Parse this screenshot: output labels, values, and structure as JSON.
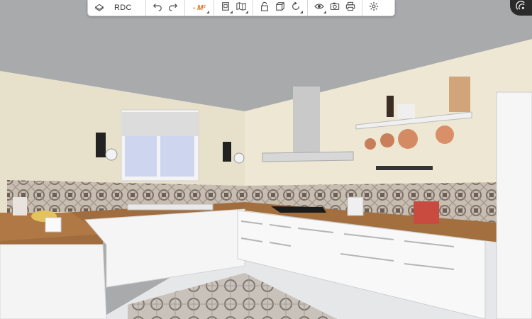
{
  "toolbar": {
    "level_label": "RDC",
    "unit_label": "- M²"
  },
  "icons": {
    "level": "floor-plan-icon",
    "undo": "undo-icon",
    "redo": "redo-icon",
    "plan2d": "plan-2d-icon",
    "map": "map-icon",
    "lock": "lock-icon",
    "cube3d": "cube-3d-icon",
    "rotate": "rotate-view-icon",
    "visibility": "eye-icon",
    "camera": "camera-icon",
    "print": "print-icon",
    "settings": "gear-icon",
    "corner": "viewer-mode-icon"
  },
  "colors": {
    "accent_unit": "#e0701e",
    "toolbar_bg": "#ffffff",
    "corner_bg": "#2b2b2b",
    "wall": "#e8e2cf",
    "ceiling": "#a9aaac",
    "countertop": "#9b6a3e",
    "cabinets": "#f7f7f7"
  }
}
